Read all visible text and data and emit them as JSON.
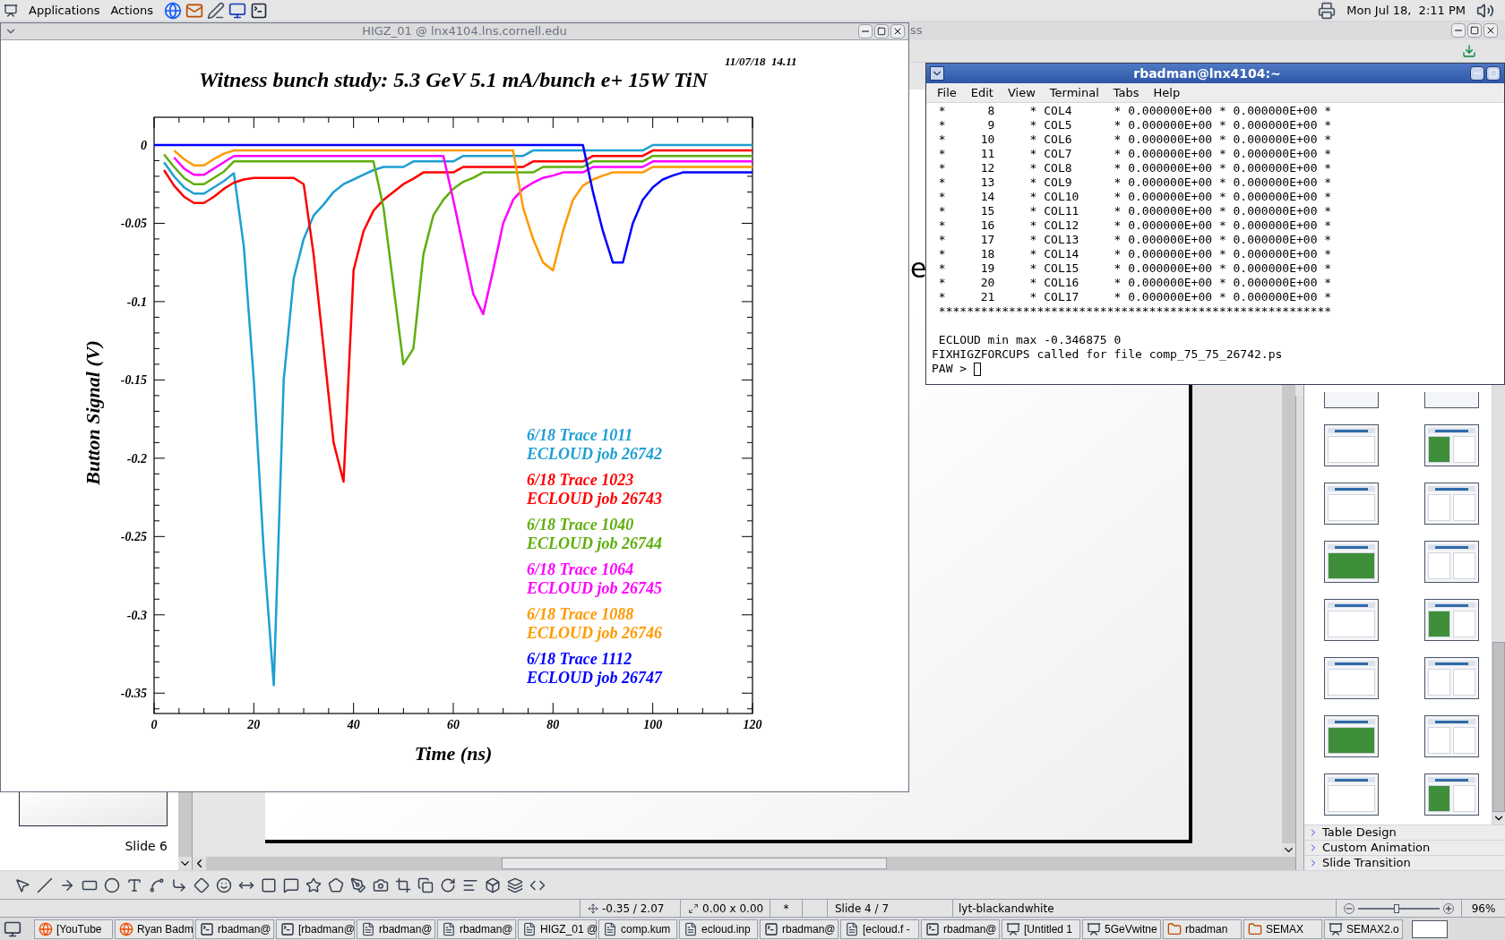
{
  "top_panel": {
    "menus": [
      "Applications",
      "Actions"
    ],
    "clock": "Mon Jul 18,  2:11 PM"
  },
  "impress": {
    "title": "ss",
    "slide_text": "e",
    "thumbnail_label": "Slide 6",
    "task_pane_sections": [
      {
        "label": "Table Design",
        "expanded": false
      },
      {
        "label": "Custom Animation",
        "expanded": false
      },
      {
        "label": "Slide Transition",
        "expanded": false
      }
    ],
    "status_bar": {
      "position": "-0.35 / 2.07",
      "size": "0.00 x 0.00",
      "modified": "*",
      "slide": "Slide 4 / 7",
      "layout": "lyt-blackandwhite",
      "zoom": {
        "level": 0.47
      },
      "zoom_percent": "96%"
    }
  },
  "higz_window": {
    "title": "HIGZ_01 @ lnx4104.lns.cornell.edu",
    "timestamp": "11/07/18  14.11",
    "legend_jobs": [
      "ECLOUD job 26742",
      "ECLOUD job 26743",
      "ECLOUD job 26744",
      "ECLOUD job 26745",
      "ECLOUD job 26746",
      "ECLOUD job 26747"
    ],
    "chart_data": {
      "type": "line",
      "title": "Witness bunch study: 5.3 GeV 5.1 mA/bunch e+ 15W TiN",
      "xlabel": "Time (ns)",
      "ylabel": "Button Signal (V)",
      "x": [
        0,
        2,
        4,
        6,
        8,
        10,
        12,
        14,
        16,
        18,
        20,
        22,
        24,
        26,
        28,
        30,
        32,
        34,
        36,
        38,
        40,
        42,
        44,
        46,
        48,
        50,
        52,
        54,
        56,
        58,
        60,
        62,
        64,
        66,
        68,
        70,
        72,
        74,
        76,
        78,
        80,
        82,
        84,
        86,
        88,
        90,
        92,
        94,
        96,
        98,
        100,
        102,
        104,
        106,
        108,
        110,
        112,
        114,
        116,
        118,
        120
      ],
      "xlim": [
        0,
        120
      ],
      "ylim": [
        -0.363,
        0.0177
      ],
      "xticks": [
        0,
        20,
        40,
        60,
        80,
        100,
        120
      ],
      "yticks": [
        0,
        -0.05,
        -0.1,
        -0.15,
        -0.2,
        -0.25,
        -0.3,
        -0.35
      ],
      "series": [
        {
          "name": "6/18 Trace 1011",
          "color": "#1e9fd2",
          "values": [
            null,
            -0.011,
            -0.02,
            -0.027,
            -0.031,
            -0.031,
            -0.027,
            -0.023,
            -0.018,
            -0.065,
            -0.15,
            -0.26,
            -0.345,
            -0.15,
            -0.085,
            -0.06,
            -0.045,
            -0.038,
            -0.03,
            -0.025,
            -0.022,
            -0.019,
            -0.016,
            -0.014,
            -0.014,
            -0.014,
            -0.0105,
            -0.0105,
            -0.0105,
            -0.0105,
            -0.0105,
            -0.007,
            -0.007,
            -0.007,
            -0.007,
            -0.007,
            -0.007,
            -0.007,
            -0.0035,
            -0.0035,
            -0.0035,
            -0.0035,
            -0.0035,
            -0.0035,
            -0.0035,
            -0.0035,
            -0.0035,
            -0.0035,
            -0.0035,
            -0.0035,
            0,
            0,
            0,
            0,
            0,
            0,
            0,
            0,
            0,
            0,
            0
          ]
        },
        {
          "name": "6/18 Trace 1023",
          "color": "#ff0000",
          "values": [
            null,
            -0.016,
            -0.026,
            -0.033,
            -0.037,
            -0.037,
            -0.033,
            -0.028,
            -0.024,
            -0.022,
            -0.021,
            -0.021,
            -0.021,
            -0.021,
            -0.021,
            -0.025,
            -0.07,
            -0.13,
            -0.19,
            -0.215,
            -0.08,
            -0.055,
            -0.042,
            -0.035,
            -0.03,
            -0.025,
            -0.0215,
            -0.0175,
            -0.0175,
            -0.0175,
            -0.0175,
            -0.014,
            -0.014,
            -0.014,
            -0.014,
            -0.014,
            -0.014,
            -0.014,
            -0.0105,
            -0.0105,
            -0.0105,
            -0.0105,
            -0.0105,
            -0.0105,
            -0.007,
            -0.007,
            -0.007,
            -0.007,
            -0.007,
            -0.007,
            -0.0035,
            -0.0035,
            -0.0035,
            -0.0035,
            -0.0035,
            -0.0035,
            -0.0035,
            -0.0035,
            -0.0035,
            -0.0035,
            -0.0035
          ]
        },
        {
          "name": "6/18 Trace 1040",
          "color": "#5fae0e",
          "values": [
            null,
            -0.006,
            -0.014,
            -0.021,
            -0.025,
            -0.025,
            -0.021,
            -0.017,
            -0.0105,
            -0.0105,
            -0.0105,
            -0.0105,
            -0.0105,
            -0.0105,
            -0.0105,
            -0.0105,
            -0.0105,
            -0.0105,
            -0.0105,
            -0.0105,
            -0.0105,
            -0.0105,
            -0.0105,
            -0.04,
            -0.09,
            -0.14,
            -0.13,
            -0.07,
            -0.045,
            -0.035,
            -0.028,
            -0.0235,
            -0.021,
            -0.0175,
            -0.0175,
            -0.0175,
            -0.0175,
            -0.0175,
            -0.0175,
            -0.014,
            -0.014,
            -0.014,
            -0.014,
            -0.014,
            -0.0105,
            -0.0105,
            -0.0105,
            -0.0105,
            -0.0105,
            -0.0105,
            -0.007,
            -0.007,
            -0.007,
            -0.007,
            -0.007,
            -0.007,
            -0.007,
            -0.007,
            -0.007,
            -0.007,
            -0.007
          ]
        },
        {
          "name": "6/18 Trace 1064",
          "color": "#ff00ff",
          "values": [
            null,
            null,
            -0.008,
            -0.015,
            -0.019,
            -0.019,
            -0.015,
            -0.011,
            -0.007,
            -0.007,
            -0.007,
            -0.007,
            -0.007,
            -0.007,
            -0.007,
            -0.007,
            -0.007,
            -0.007,
            -0.007,
            -0.007,
            -0.007,
            -0.007,
            -0.007,
            -0.007,
            -0.007,
            -0.007,
            -0.007,
            -0.007,
            -0.007,
            -0.007,
            -0.035,
            -0.065,
            -0.095,
            -0.108,
            -0.08,
            -0.05,
            -0.035,
            -0.028,
            -0.024,
            -0.021,
            -0.0195,
            -0.0175,
            -0.0175,
            -0.0175,
            -0.014,
            -0.014,
            -0.014,
            -0.014,
            -0.014,
            -0.014,
            -0.0105,
            -0.0105,
            -0.0105,
            -0.0105,
            -0.0105,
            -0.0105,
            -0.0105,
            -0.0105,
            -0.0105,
            -0.0105,
            -0.0105
          ]
        },
        {
          "name": "6/18 Trace 1088",
          "color": "#ff9900",
          "values": [
            null,
            null,
            -0.0035,
            -0.009,
            -0.013,
            -0.013,
            -0.009,
            -0.0055,
            -0.0035,
            -0.0035,
            -0.0035,
            -0.0035,
            -0.0035,
            -0.0035,
            -0.0035,
            -0.0035,
            -0.0035,
            -0.0035,
            -0.0035,
            -0.0035,
            -0.0035,
            -0.0035,
            -0.0035,
            -0.0035,
            -0.0035,
            -0.0035,
            -0.0035,
            -0.0035,
            -0.0035,
            -0.0035,
            -0.0035,
            -0.0035,
            -0.0035,
            -0.0035,
            -0.0035,
            -0.0035,
            -0.0035,
            -0.04,
            -0.06,
            -0.075,
            -0.08,
            -0.055,
            -0.035,
            -0.026,
            -0.022,
            -0.0195,
            -0.0175,
            -0.0175,
            -0.0175,
            -0.0175,
            -0.014,
            -0.014,
            -0.014,
            -0.014,
            -0.014,
            -0.014,
            -0.014,
            -0.014,
            -0.014,
            -0.014,
            -0.014
          ]
        },
        {
          "name": "6/18 Trace 1112",
          "color": "#0000ff",
          "values": [
            0,
            0,
            0,
            0,
            0,
            0,
            0,
            0,
            0,
            0,
            0,
            0,
            0,
            0,
            0,
            0,
            0,
            0,
            0,
            0,
            0,
            0,
            0,
            0,
            0,
            0,
            0,
            0,
            0,
            0,
            0,
            0,
            0,
            0,
            0,
            0,
            0,
            0,
            0,
            0,
            0,
            0,
            0,
            0,
            -0.03,
            -0.055,
            -0.075,
            -0.075,
            -0.05,
            -0.035,
            -0.027,
            -0.022,
            -0.0195,
            -0.0175,
            -0.0175,
            -0.0175,
            -0.0175,
            -0.0175,
            -0.0175,
            -0.0175,
            -0.0175
          ]
        }
      ]
    }
  },
  "terminal": {
    "title": "rbadman@lnx4104:~",
    "menu": [
      "File",
      "Edit",
      "View",
      "Terminal",
      "Tabs",
      "Help"
    ],
    "output": [
      " *      8     * COL4      * 0.000000E+00 * 0.000000E+00 *",
      " *      9     * COL5      * 0.000000E+00 * 0.000000E+00 *",
      " *     10     * COL6      * 0.000000E+00 * 0.000000E+00 *",
      " *     11     * COL7      * 0.000000E+00 * 0.000000E+00 *",
      " *     12     * COL8      * 0.000000E+00 * 0.000000E+00 *",
      " *     13     * COL9      * 0.000000E+00 * 0.000000E+00 *",
      " *     14     * COL10     * 0.000000E+00 * 0.000000E+00 *",
      " *     15     * COL11     * 0.000000E+00 * 0.000000E+00 *",
      " *     16     * COL12     * 0.000000E+00 * 0.000000E+00 *",
      " *     17     * COL13     * 0.000000E+00 * 0.000000E+00 *",
      " *     18     * COL14     * 0.000000E+00 * 0.000000E+00 *",
      " *     19     * COL15     * 0.000000E+00 * 0.000000E+00 *",
      " *     20     * COL16     * 0.000000E+00 * 0.000000E+00 *",
      " *     21     * COL17     * 0.000000E+00 * 0.000000E+00 *",
      " ********************************************************"
    ],
    "messages": [
      " ECLOUD min max -0.346875 0",
      "FIXHIGZFORCUPS called for file comp_75_75_26742.ps"
    ],
    "prompt": "PAW > "
  },
  "taskbar": {
    "items": [
      {
        "label": "[YouTube",
        "kind": "browser"
      },
      {
        "label": "Ryan Badm",
        "kind": "browser"
      },
      {
        "label": "rbadman@",
        "kind": "terminal"
      },
      {
        "label": "[rbadman@",
        "kind": "terminal"
      },
      {
        "label": "rbadman@",
        "kind": "document"
      },
      {
        "label": "rbadman@",
        "kind": "document"
      },
      {
        "label": "HIGZ_01 @",
        "kind": "document"
      },
      {
        "label": "comp.kum",
        "kind": "document"
      },
      {
        "label": "ecloud.inp",
        "kind": "document"
      },
      {
        "label": "rbadman@",
        "kind": "terminal"
      },
      {
        "label": "[ecloud.f -",
        "kind": "document"
      },
      {
        "label": "rbadman@",
        "kind": "terminal"
      },
      {
        "label": "[Untitled 1",
        "kind": "presentation"
      },
      {
        "label": "5GeVwitne",
        "kind": "presentation"
      },
      {
        "label": "rbadman",
        "kind": "folder"
      },
      {
        "label": "SEMAX",
        "kind": "folder"
      },
      {
        "label": "SEMAX2.o",
        "kind": "presentation"
      }
    ]
  }
}
